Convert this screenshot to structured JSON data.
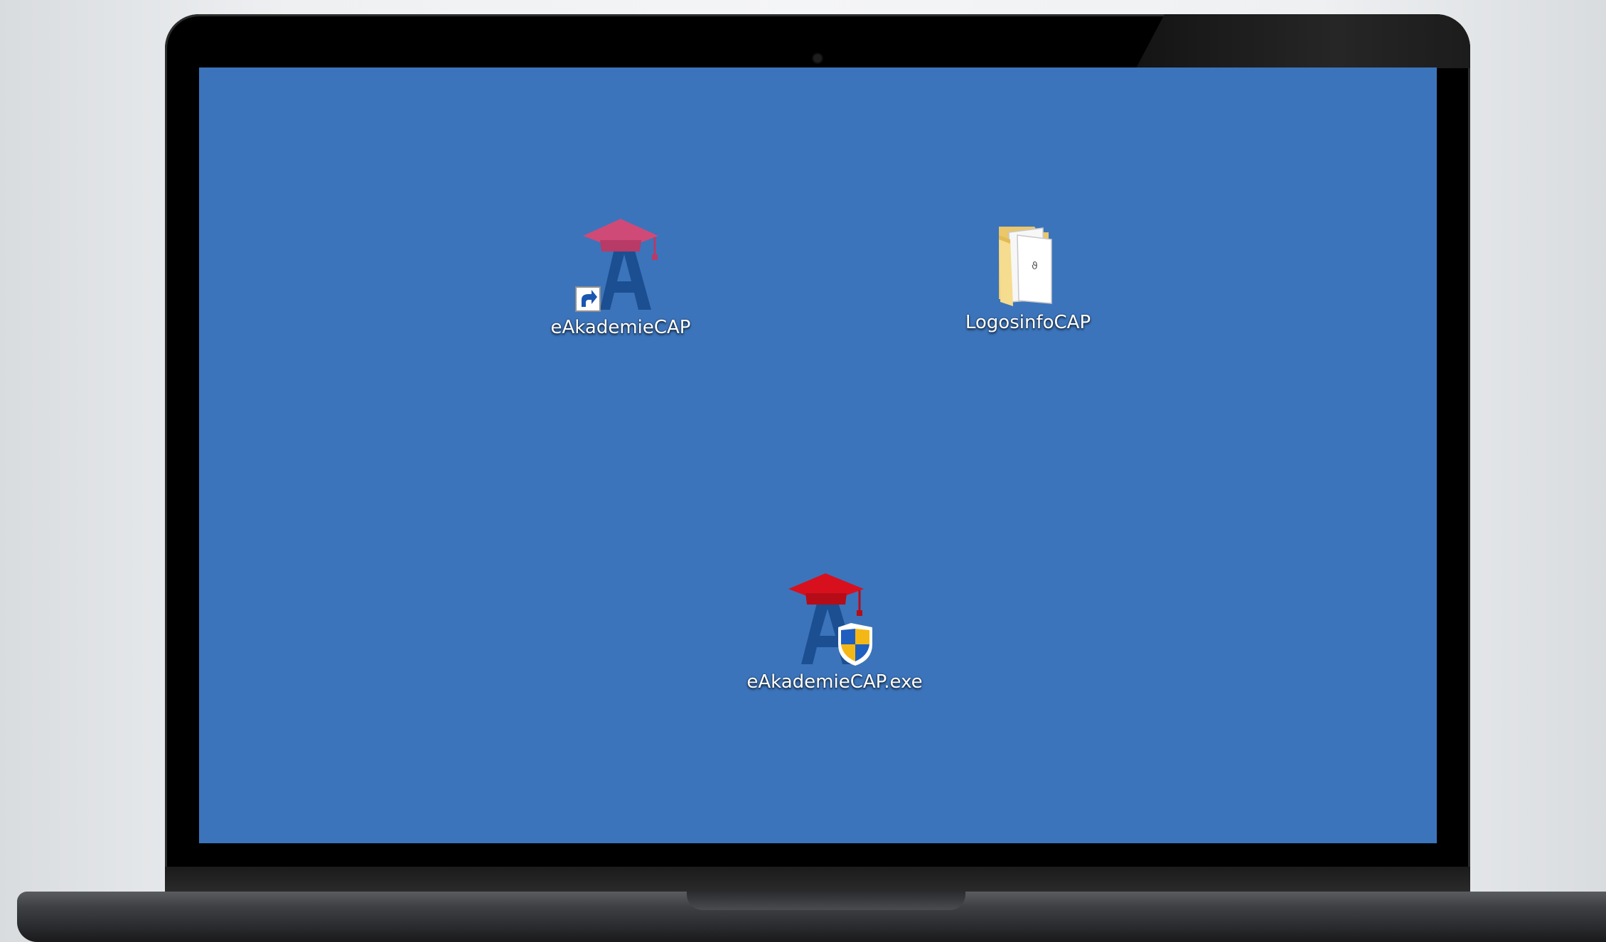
{
  "desktop": {
    "background_color": "#3b74bb",
    "icons": [
      {
        "label": "eAkademieCAP",
        "icon": "eakademie-shortcut-icon",
        "cap_color": "#d04a78"
      },
      {
        "label": "LogosinfoCAP",
        "icon": "folder-icon",
        "folder_color": "#f1d88a"
      },
      {
        "label": "eAkademieCAP.exe",
        "icon": "eakademie-installer-icon",
        "cap_color": "#d8101e",
        "shield_colors": [
          "#1f5fbf",
          "#f4b816"
        ]
      }
    ]
  }
}
